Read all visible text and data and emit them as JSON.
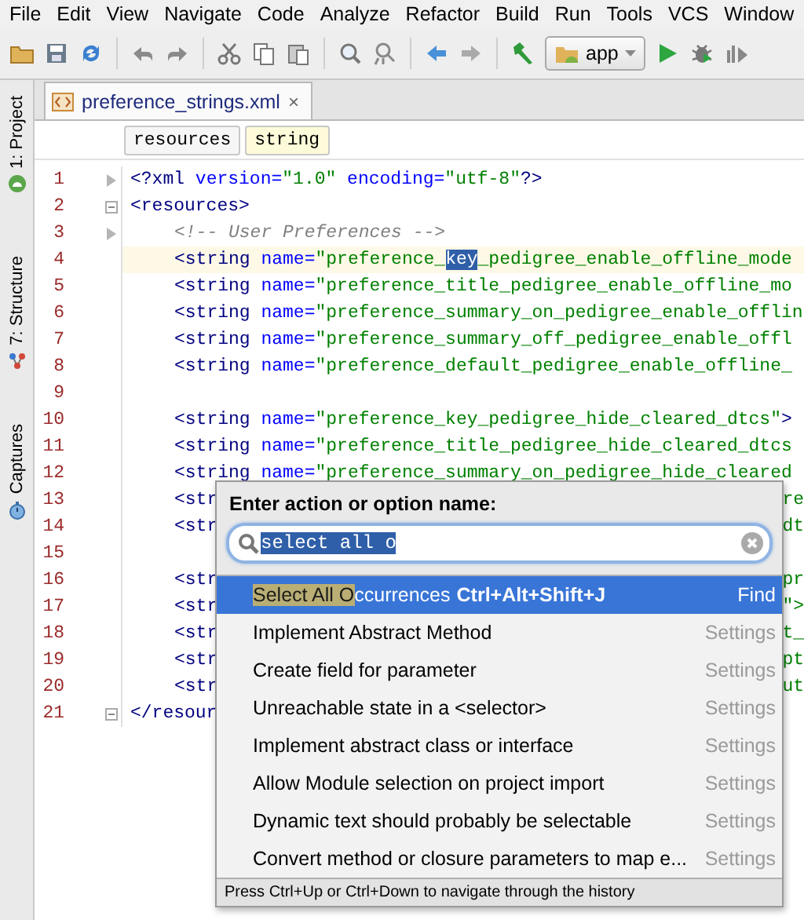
{
  "menu": [
    {
      "label": "File"
    },
    {
      "label": "Edit"
    },
    {
      "label": "View"
    },
    {
      "label": "Navigate"
    },
    {
      "label": "Code"
    },
    {
      "label": "Analyze"
    },
    {
      "label": "Refactor"
    },
    {
      "label": "Build"
    },
    {
      "label": "Run"
    },
    {
      "label": "Tools"
    },
    {
      "label": "VCS"
    },
    {
      "label": "Window"
    }
  ],
  "toolbar": {
    "run_config": "app"
  },
  "side_panels": [
    {
      "label": "1: Project",
      "kind": "project"
    },
    {
      "label": "7: Structure",
      "kind": "structure"
    },
    {
      "label": "Captures",
      "kind": "captures"
    }
  ],
  "editor_tab": {
    "title": "preference_strings.xml",
    "close": "×"
  },
  "breadcrumbs": [
    {
      "label": "resources",
      "selected": false
    },
    {
      "label": "string",
      "selected": true
    }
  ],
  "lines": [
    {
      "number": "1",
      "kind": "arrow",
      "indent": false,
      "current": false,
      "tokens": [
        {
          "kind": "tag",
          "text": "<?xml "
        },
        {
          "kind": "attr",
          "text": "version="
        },
        {
          "kind": "value",
          "text": "\"1.0\""
        },
        {
          "kind": "attr",
          "text": " encoding="
        },
        {
          "kind": "value",
          "text": "\"utf-8\""
        },
        {
          "kind": "tag",
          "text": "?>"
        }
      ]
    },
    {
      "number": "2",
      "kind": "fold",
      "indent": false,
      "current": false,
      "tokens": [
        {
          "kind": "tag",
          "text": "<resources>"
        }
      ]
    },
    {
      "number": "3",
      "kind": "arrow",
      "indent": true,
      "current": false,
      "tokens": [
        {
          "kind": "comment",
          "text": "<!-- User Preferences -->"
        }
      ]
    },
    {
      "number": "4",
      "indent": true,
      "current": true,
      "tokens": [
        {
          "kind": "tag",
          "text": "<string "
        },
        {
          "kind": "attr",
          "text": "name="
        },
        {
          "kind": "value",
          "text": "\"preference_"
        },
        {
          "kind": "match",
          "text": "key"
        },
        {
          "kind": "value",
          "text": "_pedigree_enable_offline_mode"
        }
      ]
    },
    {
      "number": "5",
      "indent": true,
      "current": false,
      "tokens": [
        {
          "kind": "tag",
          "text": "<string "
        },
        {
          "kind": "attr",
          "text": "name="
        },
        {
          "kind": "value",
          "text": "\"preference_title_pedigree_enable_offline_mo"
        }
      ]
    },
    {
      "number": "6",
      "indent": true,
      "current": false,
      "tokens": [
        {
          "kind": "tag",
          "text": "<string "
        },
        {
          "kind": "attr",
          "text": "name="
        },
        {
          "kind": "value",
          "text": "\"preference_summary_on_pedigree_enable_offlin"
        }
      ]
    },
    {
      "number": "7",
      "indent": true,
      "current": false,
      "tokens": [
        {
          "kind": "tag",
          "text": "<string "
        },
        {
          "kind": "attr",
          "text": "name="
        },
        {
          "kind": "value",
          "text": "\"preference_summary_off_pedigree_enable_offl"
        }
      ]
    },
    {
      "number": "8",
      "indent": true,
      "current": false,
      "tokens": [
        {
          "kind": "tag",
          "text": "<string "
        },
        {
          "kind": "attr",
          "text": "name="
        },
        {
          "kind": "value",
          "text": "\"preference_default_pedigree_enable_offline_"
        }
      ]
    },
    {
      "number": "9",
      "current": false
    },
    {
      "number": "10",
      "indent": true,
      "current": false,
      "tokens": [
        {
          "kind": "tag",
          "text": "<string "
        },
        {
          "kind": "attr",
          "text": "name="
        },
        {
          "kind": "value",
          "text": "\"preference_key_pedigree_hide_cleared_dtcs\""
        },
        {
          "kind": "tag",
          "text": ">"
        }
      ]
    },
    {
      "number": "11",
      "indent": true,
      "current": false,
      "tokens": [
        {
          "kind": "tag",
          "text": "<string "
        },
        {
          "kind": "attr",
          "text": "name="
        },
        {
          "kind": "value",
          "text": "\"preference_title_pedigree_hide_cleared_dtcs"
        }
      ]
    },
    {
      "number": "12",
      "indent": true,
      "current": false,
      "tokens": [
        {
          "kind": "tag",
          "text": "<string "
        },
        {
          "kind": "attr",
          "text": "name="
        },
        {
          "kind": "value",
          "text": "\"preference_summary_on_pedigree_hide_cleared"
        }
      ]
    },
    {
      "number": "13",
      "indent": true,
      "current": false,
      "tokens": [
        {
          "kind": "tag",
          "text": "<str"
        }
      ],
      "tail": {
        "kind": "value",
        "text": "re"
      }
    },
    {
      "number": "14",
      "indent": true,
      "current": false,
      "tokens": [
        {
          "kind": "tag",
          "text": "<str"
        }
      ],
      "tail": {
        "kind": "value",
        "text": "dt"
      }
    },
    {
      "number": "15",
      "current": false
    },
    {
      "number": "16",
      "indent": true,
      "current": false,
      "tokens": [
        {
          "kind": "tag",
          "text": "<str"
        }
      ],
      "tail": {
        "kind": "value",
        "text": "pr"
      }
    },
    {
      "number": "17",
      "indent": true,
      "current": false,
      "tokens": [
        {
          "kind": "tag",
          "text": "<str"
        }
      ],
      "tail": {
        "kind": "value",
        "text": "\">"
      }
    },
    {
      "number": "18",
      "indent": true,
      "current": false,
      "tokens": [
        {
          "kind": "tag",
          "text": "<str"
        }
      ],
      "tail": {
        "kind": "value",
        "text": "t_"
      }
    },
    {
      "number": "19",
      "indent": true,
      "current": false,
      "tokens": [
        {
          "kind": "tag",
          "text": "<str"
        }
      ],
      "tail": {
        "kind": "value",
        "text": "pt"
      }
    },
    {
      "number": "20",
      "indent": true,
      "current": false,
      "tokens": [
        {
          "kind": "tag",
          "text": "<str"
        }
      ],
      "tail": {
        "kind": "value",
        "text": "ut"
      }
    },
    {
      "number": "21",
      "kind": "fold",
      "indent": false,
      "current": false,
      "tokens": [
        {
          "kind": "tag",
          "text": "</resour"
        }
      ]
    }
  ],
  "popup": {
    "title": "Enter action or option name:",
    "search": {
      "value": "select all o",
      "text_selected": true
    },
    "items": [
      {
        "match": "Select All O",
        "name": "ccurrences",
        "shortcut": "Ctrl+Alt+Shift+J",
        "group": "Find",
        "selected": true
      },
      {
        "name": "Implement Abstract Method",
        "group": "Settings",
        "selected": false
      },
      {
        "name": "Create field for parameter",
        "group": "Settings",
        "selected": false
      },
      {
        "name": "Unreachable state in a <selector>",
        "group": "Settings",
        "selected": false
      },
      {
        "name": "Implement abstract class or interface",
        "group": "Settings",
        "selected": false
      },
      {
        "name": "Allow Module selection on project import",
        "group": "Settings",
        "selected": false
      },
      {
        "name": "Dynamic text should probably be selectable",
        "group": "Settings",
        "selected": false
      },
      {
        "name": "Convert method or closure parameters to map e...",
        "group": "Settings",
        "selected": false
      }
    ],
    "hint": "Press Ctrl+Up or Ctrl+Down to navigate through the history"
  }
}
